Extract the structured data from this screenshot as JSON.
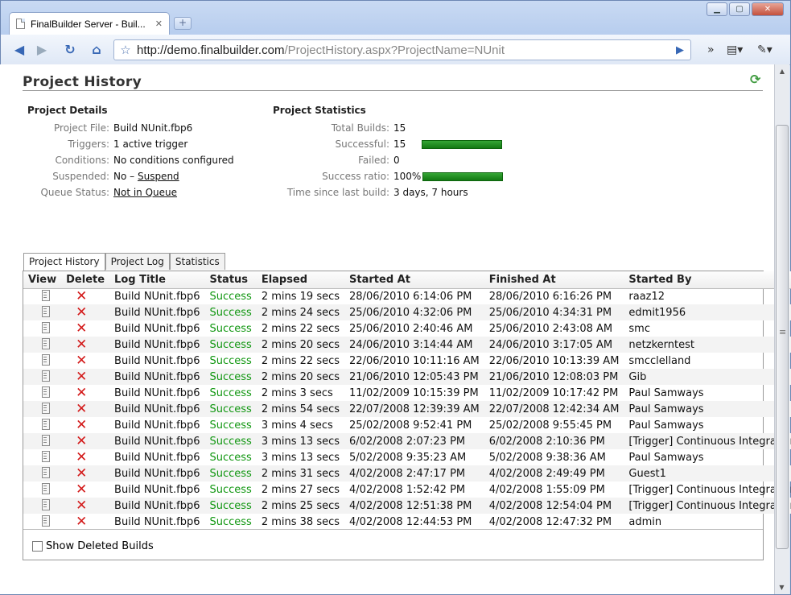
{
  "browser": {
    "tab_title": "FinalBuilder Server - Buil...",
    "tab_close": "✕",
    "new_tab": "+",
    "url_host": "http://demo.finalbuilder.com",
    "url_path": "/ProjectHistory.aspx?ProjectName=NUnit"
  },
  "page": {
    "title": "Project History"
  },
  "details": {
    "heading": "Project Details",
    "project_file_label": "Project File:",
    "project_file": "Build NUnit.fbp6",
    "triggers_label": "Triggers:",
    "triggers": "1 active trigger",
    "conditions_label": "Conditions:",
    "conditions": "No conditions configured",
    "suspended_label": "Suspended:",
    "suspended_value": "No –",
    "suspend_link": "Suspend",
    "queue_label": "Queue Status:",
    "queue_link": "Not in Queue"
  },
  "stats": {
    "heading": "Project Statistics",
    "total_label": "Total Builds:",
    "total": "15",
    "successful_label": "Successful:",
    "successful": "15",
    "successful_fraction": 1.0,
    "failed_label": "Failed:",
    "failed": "0",
    "ratio_label": "Success ratio:",
    "ratio": "100%",
    "ratio_fraction": 1.0,
    "since_label": "Time since last build:",
    "since": "3 days, 7 hours"
  },
  "tabs": [
    "Project History",
    "Project Log",
    "Statistics"
  ],
  "table": {
    "headers": [
      "View",
      "Delete",
      "Log Title",
      "Status",
      "Elapsed",
      "Started At",
      "Finished At",
      "Started By"
    ],
    "rows": [
      [
        "Build NUnit.fbp6",
        "Success",
        "2 mins 19 secs",
        "28/06/2010 6:14:06 PM",
        "28/06/2010 6:16:26 PM",
        "raaz12"
      ],
      [
        "Build NUnit.fbp6",
        "Success",
        "2 mins 24 secs",
        "25/06/2010 4:32:06 PM",
        "25/06/2010 4:34:31 PM",
        "edmit1956"
      ],
      [
        "Build NUnit.fbp6",
        "Success",
        "2 mins 22 secs",
        "25/06/2010 2:40:46 AM",
        "25/06/2010 2:43:08 AM",
        "smc"
      ],
      [
        "Build NUnit.fbp6",
        "Success",
        "2 mins 20 secs",
        "24/06/2010 3:14:44 AM",
        "24/06/2010 3:17:05 AM",
        "netzkerntest"
      ],
      [
        "Build NUnit.fbp6",
        "Success",
        "2 mins 22 secs",
        "22/06/2010 10:11:16 AM",
        "22/06/2010 10:13:39 AM",
        "smcclelland"
      ],
      [
        "Build NUnit.fbp6",
        "Success",
        "2 mins 20 secs",
        "21/06/2010 12:05:43 PM",
        "21/06/2010 12:08:03 PM",
        "Gib"
      ],
      [
        "Build NUnit.fbp6",
        "Success",
        "2 mins 3 secs",
        "11/02/2009 10:15:39 PM",
        "11/02/2009 10:17:42 PM",
        "Paul Samways"
      ],
      [
        "Build NUnit.fbp6",
        "Success",
        "2 mins 54 secs",
        "22/07/2008 12:39:39 AM",
        "22/07/2008 12:42:34 AM",
        "Paul Samways"
      ],
      [
        "Build NUnit.fbp6",
        "Success",
        "3 mins 4 secs",
        "25/02/2008 9:52:41 PM",
        "25/02/2008 9:55:45 PM",
        "Paul Samways"
      ],
      [
        "Build NUnit.fbp6",
        "Success",
        "3 mins 13 secs",
        "6/02/2008 2:07:23 PM",
        "6/02/2008 2:10:36 PM",
        "[Trigger] Continuous Integration"
      ],
      [
        "Build NUnit.fbp6",
        "Success",
        "3 mins 13 secs",
        "5/02/2008 9:35:23 AM",
        "5/02/2008 9:38:36 AM",
        "Paul Samways"
      ],
      [
        "Build NUnit.fbp6",
        "Success",
        "2 mins 31 secs",
        "4/02/2008 2:47:17 PM",
        "4/02/2008 2:49:49 PM",
        "Guest1"
      ],
      [
        "Build NUnit.fbp6",
        "Success",
        "2 mins 27 secs",
        "4/02/2008 1:52:42 PM",
        "4/02/2008 1:55:09 PM",
        "[Trigger] Continuous Integration"
      ],
      [
        "Build NUnit.fbp6",
        "Success",
        "2 mins 25 secs",
        "4/02/2008 12:51:38 PM",
        "4/02/2008 12:54:04 PM",
        "[Trigger] Continuous Integration"
      ],
      [
        "Build NUnit.fbp6",
        "Success",
        "2 mins 38 secs",
        "4/02/2008 12:44:53 PM",
        "4/02/2008 12:47:32 PM",
        "admin"
      ]
    ]
  },
  "show_deleted_label": "Show Deleted Builds",
  "colors": {
    "success": "#119711",
    "delete": "#d31a1a",
    "bar": "#1d8a1d"
  }
}
